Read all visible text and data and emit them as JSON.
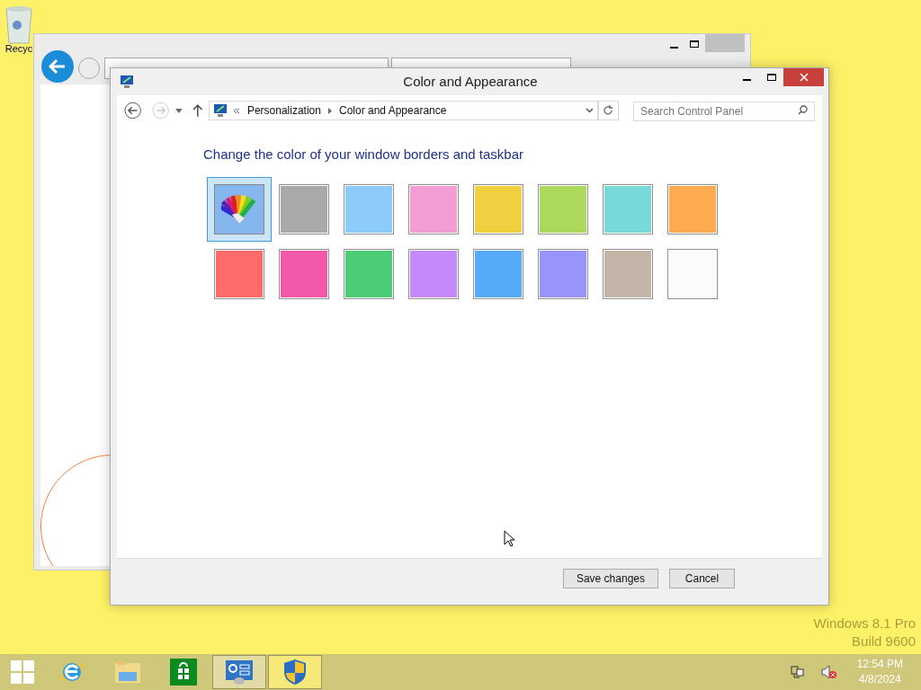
{
  "desktop": {
    "icons": [
      {
        "label": "Recyc"
      }
    ],
    "watermark": [
      "Windows 8.1 Pro",
      "Build 9600"
    ]
  },
  "window": {
    "title": "Color and Appearance",
    "breadcrumb": [
      {
        "label": "Personalization"
      },
      {
        "label": "Color and Appearance"
      }
    ],
    "search": {
      "placeholder": "Search Control Panel"
    },
    "heading": "Change the color of your window borders and taskbar",
    "swatches": [
      {
        "kind": "custom",
        "selected": true
      },
      {
        "kind": "color",
        "color": "#a9a9a9",
        "selected": false
      },
      {
        "kind": "color",
        "color": "#8ccbfa",
        "selected": false
      },
      {
        "kind": "color",
        "color": "#f29dd4",
        "selected": false
      },
      {
        "kind": "color",
        "color": "#f0d040",
        "selected": false
      },
      {
        "kind": "color",
        "color": "#acd85c",
        "selected": false
      },
      {
        "kind": "color",
        "color": "#79d8d8",
        "selected": false
      },
      {
        "kind": "color",
        "color": "#fdaa50",
        "selected": false
      },
      {
        "kind": "color",
        "color": "#ff6b6b",
        "selected": false
      },
      {
        "kind": "color",
        "color": "#f25aa9",
        "selected": false
      },
      {
        "kind": "color",
        "color": "#4acd74",
        "selected": false
      },
      {
        "kind": "color",
        "color": "#c589f9",
        "selected": false
      },
      {
        "kind": "color",
        "color": "#55abf9",
        "selected": false
      },
      {
        "kind": "color",
        "color": "#9795fa",
        "selected": false
      },
      {
        "kind": "color",
        "color": "#c3b5a7",
        "selected": false
      },
      {
        "kind": "color",
        "color": "#fbfbfb",
        "selected": false
      }
    ],
    "buttons": [
      "Save changes",
      "Cancel"
    ]
  },
  "taskbar": {
    "apps": [
      {
        "kind": "ie",
        "open": false,
        "selected": false
      },
      {
        "kind": "explorer",
        "open": false,
        "selected": false
      },
      {
        "kind": "store",
        "open": false,
        "selected": false
      },
      {
        "kind": "control",
        "open": true,
        "selected": false
      },
      {
        "kind": "shield",
        "open": true,
        "selected": true
      }
    ],
    "time": "12:54 PM",
    "date": "4/8/2024"
  }
}
